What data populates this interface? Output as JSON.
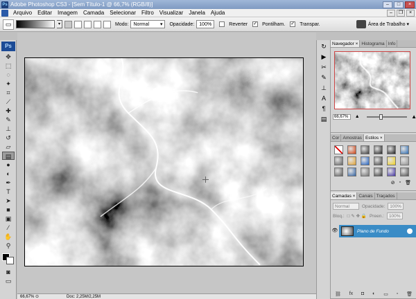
{
  "window": {
    "title": "Adobe Photoshop CS3 - [Sem Título-1 @ 66,7% (RGB/8)]",
    "app_icon_text": "Ps",
    "minimize_label": "–",
    "maximize_label": "□",
    "close_label": "×"
  },
  "menu": {
    "items": [
      "Arquivo",
      "Editar",
      "Imagem",
      "Camada",
      "Selecionar",
      "Filtro",
      "Visualizar",
      "Janela",
      "Ajuda"
    ]
  },
  "options": {
    "mode_label": "Modo:",
    "mode_value": "Normal",
    "opacity_label": "Opacidade:",
    "opacity_value": "100%",
    "reverse_label": "Reverter",
    "dither_label": "Pontilham.",
    "transparency_label": "Transpar.",
    "workspace_label": "Área de Trabalho ▾"
  },
  "tools": {
    "logo": "Ps"
  },
  "status": {
    "zoom": "66,67%",
    "doc_info": "Doc: 2,25M/2,25M"
  },
  "navigator": {
    "tabs": [
      "Navegador ×",
      "Histograma",
      "Info"
    ],
    "zoom": "66,67%"
  },
  "styles": {
    "tabs": [
      "Cor",
      "Amostras",
      "Estilos ×"
    ],
    "swatch_colors": [
      "#ffffff",
      "#d04010",
      "#3a3a3a",
      "#202020",
      "#1a1a1a",
      "#2a6ab0",
      "#606060",
      "#e0a030",
      "#2060c0",
      "#404040",
      "#f0d020",
      "#909090",
      "#5a5a5a",
      "#3060a0",
      "#707070",
      "#3a3a3a",
      "#4030a0",
      "#505050"
    ]
  },
  "layers": {
    "tabs": [
      "Camadas ×",
      "Canais",
      "Traçados"
    ],
    "blend_mode": "Normal",
    "opacity_label": "Opacidade:",
    "opacity_value": "100%",
    "lock_label": "Bloq.:",
    "fill_label": "Preen.:",
    "fill_value": "100%",
    "layer_name": "Plano de Fundo"
  }
}
